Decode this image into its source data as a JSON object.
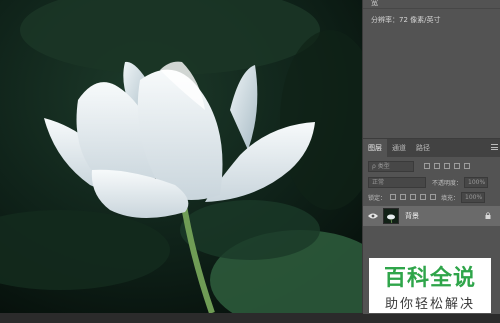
{
  "properties": {
    "top_text": "宽",
    "resolution_text": "分辨率：72 像素/英寸"
  },
  "layers_panel": {
    "tabs": [
      {
        "label": "图层",
        "active": true
      },
      {
        "label": "通道",
        "active": false
      },
      {
        "label": "路径",
        "active": false
      }
    ],
    "filter_kind": "ρ 类型",
    "blend_mode": "正常",
    "opacity_label": "不透明度：",
    "opacity_value": "100%",
    "lock_label": "锁定：",
    "fill_label": "填充：",
    "fill_value": "100%",
    "layer": {
      "name": "背景"
    }
  },
  "watermark": {
    "main": "百科全说",
    "sub": "助你轻松解决"
  },
  "colors": {
    "accent_green": "#2fa54a",
    "panel_bg": "#535353",
    "canvas_bg": "#0c1a14"
  }
}
